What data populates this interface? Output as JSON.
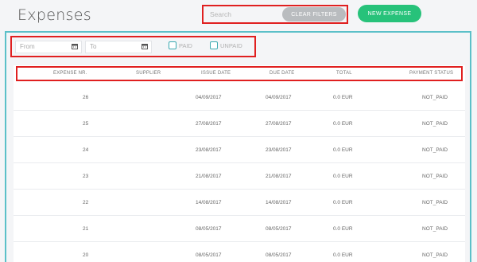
{
  "header": {
    "title": "Expenses",
    "search_placeholder": "Search",
    "clear_filters_label": "CLEAR FILTERS",
    "new_expense_label": "NEW EXPENSE"
  },
  "filters": {
    "from_placeholder": "From",
    "to_placeholder": "To",
    "paid_label": "PAID",
    "unpaid_label": "UNPAID",
    "calendar_icon": "calendar-icon"
  },
  "table": {
    "columns": [
      "EXPENSE NR.",
      "SUPPLIER",
      "ISSUE DATE",
      "DUE DATE",
      "TOTAL",
      "PAYMENT STATUS"
    ],
    "rows": [
      {
        "nr": "26",
        "supplier": "",
        "issue": "04/09/2017",
        "due": "04/09/2017",
        "total": "0.0 EUR",
        "status": "NOT_PAID"
      },
      {
        "nr": "25",
        "supplier": "",
        "issue": "27/08/2017",
        "due": "27/08/2017",
        "total": "0.0 EUR",
        "status": "NOT_PAID"
      },
      {
        "nr": "24",
        "supplier": "",
        "issue": "23/08/2017",
        "due": "23/08/2017",
        "total": "0.0 EUR",
        "status": "NOT_PAID"
      },
      {
        "nr": "23",
        "supplier": "",
        "issue": "21/08/2017",
        "due": "21/08/2017",
        "total": "0.0 EUR",
        "status": "NOT_PAID"
      },
      {
        "nr": "22",
        "supplier": "",
        "issue": "14/08/2017",
        "due": "14/08/2017",
        "total": "0.0 EUR",
        "status": "NOT_PAID"
      },
      {
        "nr": "21",
        "supplier": "",
        "issue": "08/05/2017",
        "due": "08/05/2017",
        "total": "0.0 EUR",
        "status": "NOT_PAID"
      },
      {
        "nr": "20",
        "supplier": "",
        "issue": "08/05/2017",
        "due": "08/05/2017",
        "total": "0.0 EUR",
        "status": "NOT_PAID"
      }
    ]
  },
  "colors": {
    "accent_green": "#27c27a",
    "panel_border": "#5bc0c8",
    "highlight_red": "#e02020",
    "clear_button": "#b9bcbf"
  }
}
